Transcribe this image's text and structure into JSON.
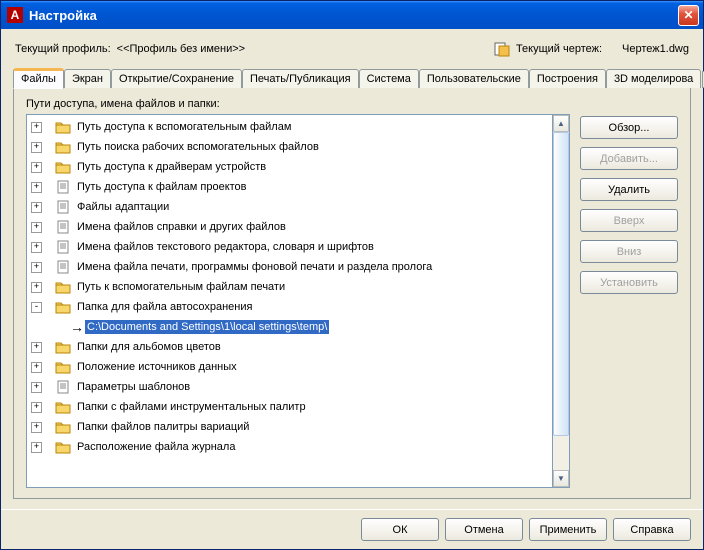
{
  "window": {
    "title": "Настройка"
  },
  "profile": {
    "label": "Текущий профиль:",
    "value": "<<Профиль без имени>>",
    "drawing_label": "Текущий чертеж:",
    "drawing_value": "Чертеж1.dwg"
  },
  "tabs": {
    "items": [
      "Файлы",
      "Экран",
      "Открытие/Сохранение",
      "Печать/Публикация",
      "Система",
      "Пользовательские",
      "Построения",
      "3D моделирова"
    ],
    "active": 0
  },
  "panel_label": "Пути доступа, имена файлов и папки:",
  "tree": [
    {
      "type": "folder",
      "expand": "+",
      "label": "Путь доступа к вспомогательным файлам"
    },
    {
      "type": "folder",
      "expand": "+",
      "label": "Путь поиска рабочих вспомогательных файлов"
    },
    {
      "type": "folder",
      "expand": "+",
      "label": "Путь доступа к драйверам устройств"
    },
    {
      "type": "file",
      "expand": "+",
      "label": "Путь доступа к файлам проектов"
    },
    {
      "type": "file",
      "expand": "+",
      "label": "Файлы адаптации"
    },
    {
      "type": "file",
      "expand": "+",
      "label": "Имена файлов справки и других файлов"
    },
    {
      "type": "file",
      "expand": "+",
      "label": "Имена файлов текстового редактора, словаря и шрифтов"
    },
    {
      "type": "file",
      "expand": "+",
      "label": "Имена файла печати, программы фоновой печати и раздела пролога"
    },
    {
      "type": "folder",
      "expand": "+",
      "label": "Путь к вспомогательным файлам печати"
    },
    {
      "type": "folder",
      "expand": "-",
      "label": "Папка для файла автосохранения"
    },
    {
      "type": "path",
      "indent": 2,
      "label": "C:\\Documents and Settings\\1\\local settings\\temp\\",
      "selected": true
    },
    {
      "type": "folder",
      "expand": "+",
      "label": "Папки для альбомов цветов"
    },
    {
      "type": "folder",
      "expand": "+",
      "label": "Положение источников данных"
    },
    {
      "type": "file",
      "expand": "+",
      "label": "Параметры шаблонов"
    },
    {
      "type": "folder",
      "expand": "+",
      "label": "Папки с файлами инструментальных палитр"
    },
    {
      "type": "folder",
      "expand": "+",
      "label": "Папки файлов палитры вариаций"
    },
    {
      "type": "folder",
      "expand": "+",
      "label": "Расположение файла журнала"
    }
  ],
  "side_buttons": {
    "browse": "Обзор...",
    "add": "Добавить...",
    "delete": "Удалить",
    "up": "Вверх",
    "down": "Вниз",
    "set": "Установить"
  },
  "dialog_buttons": {
    "ok": "ОК",
    "cancel": "Отмена",
    "apply": "Применить",
    "help": "Справка"
  }
}
